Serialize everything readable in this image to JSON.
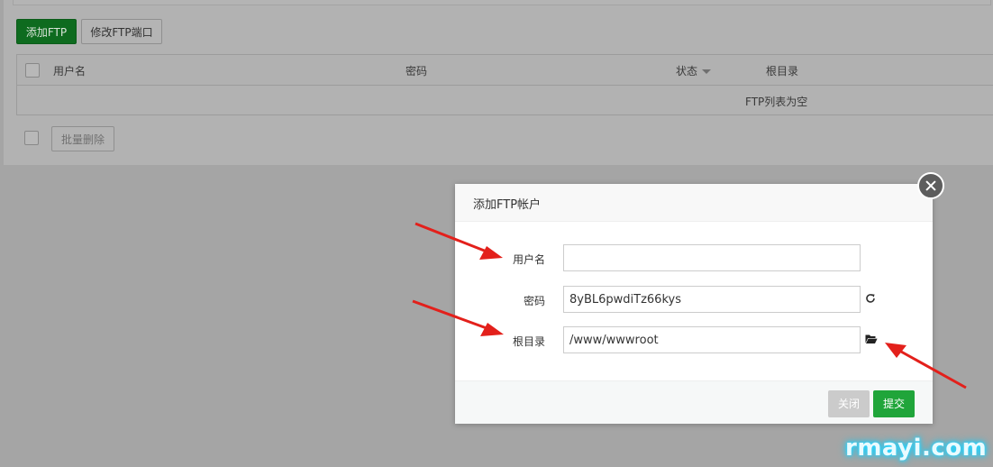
{
  "toolbar": {
    "add_ftp_label": "添加FTP",
    "modify_port_label": "修改FTP端口"
  },
  "table": {
    "columns": [
      "用户名",
      "密码",
      "状态",
      "根目录"
    ],
    "empty_text": "FTP列表为空"
  },
  "batch": {
    "delete_label": "批量删除"
  },
  "modal": {
    "title": "添加FTP帐户",
    "fields": {
      "username": {
        "label": "用户名",
        "value": ""
      },
      "password": {
        "label": "密码",
        "value": "8yBL6pwdiTz66kys"
      },
      "root_dir": {
        "label": "根目录",
        "value": "/www/wwwroot"
      }
    },
    "close_label": "关闭",
    "submit_label": "提交"
  },
  "icons": {
    "password_action": "refresh-icon",
    "root_dir_action": "folder-open-icon",
    "modal_close": "close-icon"
  },
  "colors": {
    "primary_green": "#20a53a",
    "annotation_red": "#e3201b"
  },
  "watermark": "rmayi.com"
}
